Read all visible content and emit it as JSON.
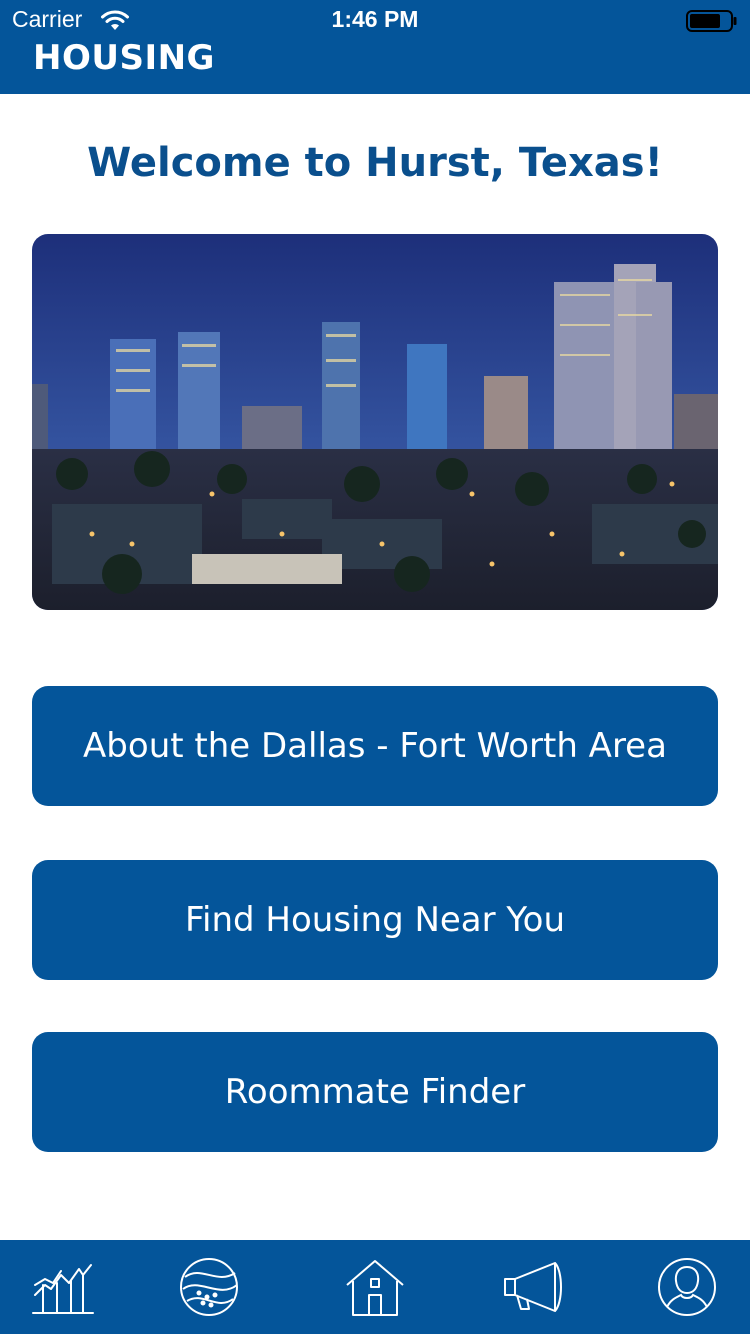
{
  "status_bar": {
    "carrier": "Carrier",
    "time": "1:46 PM"
  },
  "header": {
    "title": "HOUSING"
  },
  "main": {
    "welcome": "Welcome to Hurst, Texas!",
    "buttons": [
      {
        "label": "About the Dallas - Fort Worth Area"
      },
      {
        "label": "Find Housing Near You"
      },
      {
        "label": "Roommate Finder"
      }
    ]
  },
  "tab_bar": {
    "items": [
      {
        "icon": "chart-icon"
      },
      {
        "icon": "globe-icon"
      },
      {
        "icon": "home-icon"
      },
      {
        "icon": "megaphone-icon"
      },
      {
        "icon": "profile-icon"
      }
    ]
  },
  "colors": {
    "brand_blue": "#04559a",
    "title_blue": "#0a4f8d",
    "background": "#ffffff"
  }
}
